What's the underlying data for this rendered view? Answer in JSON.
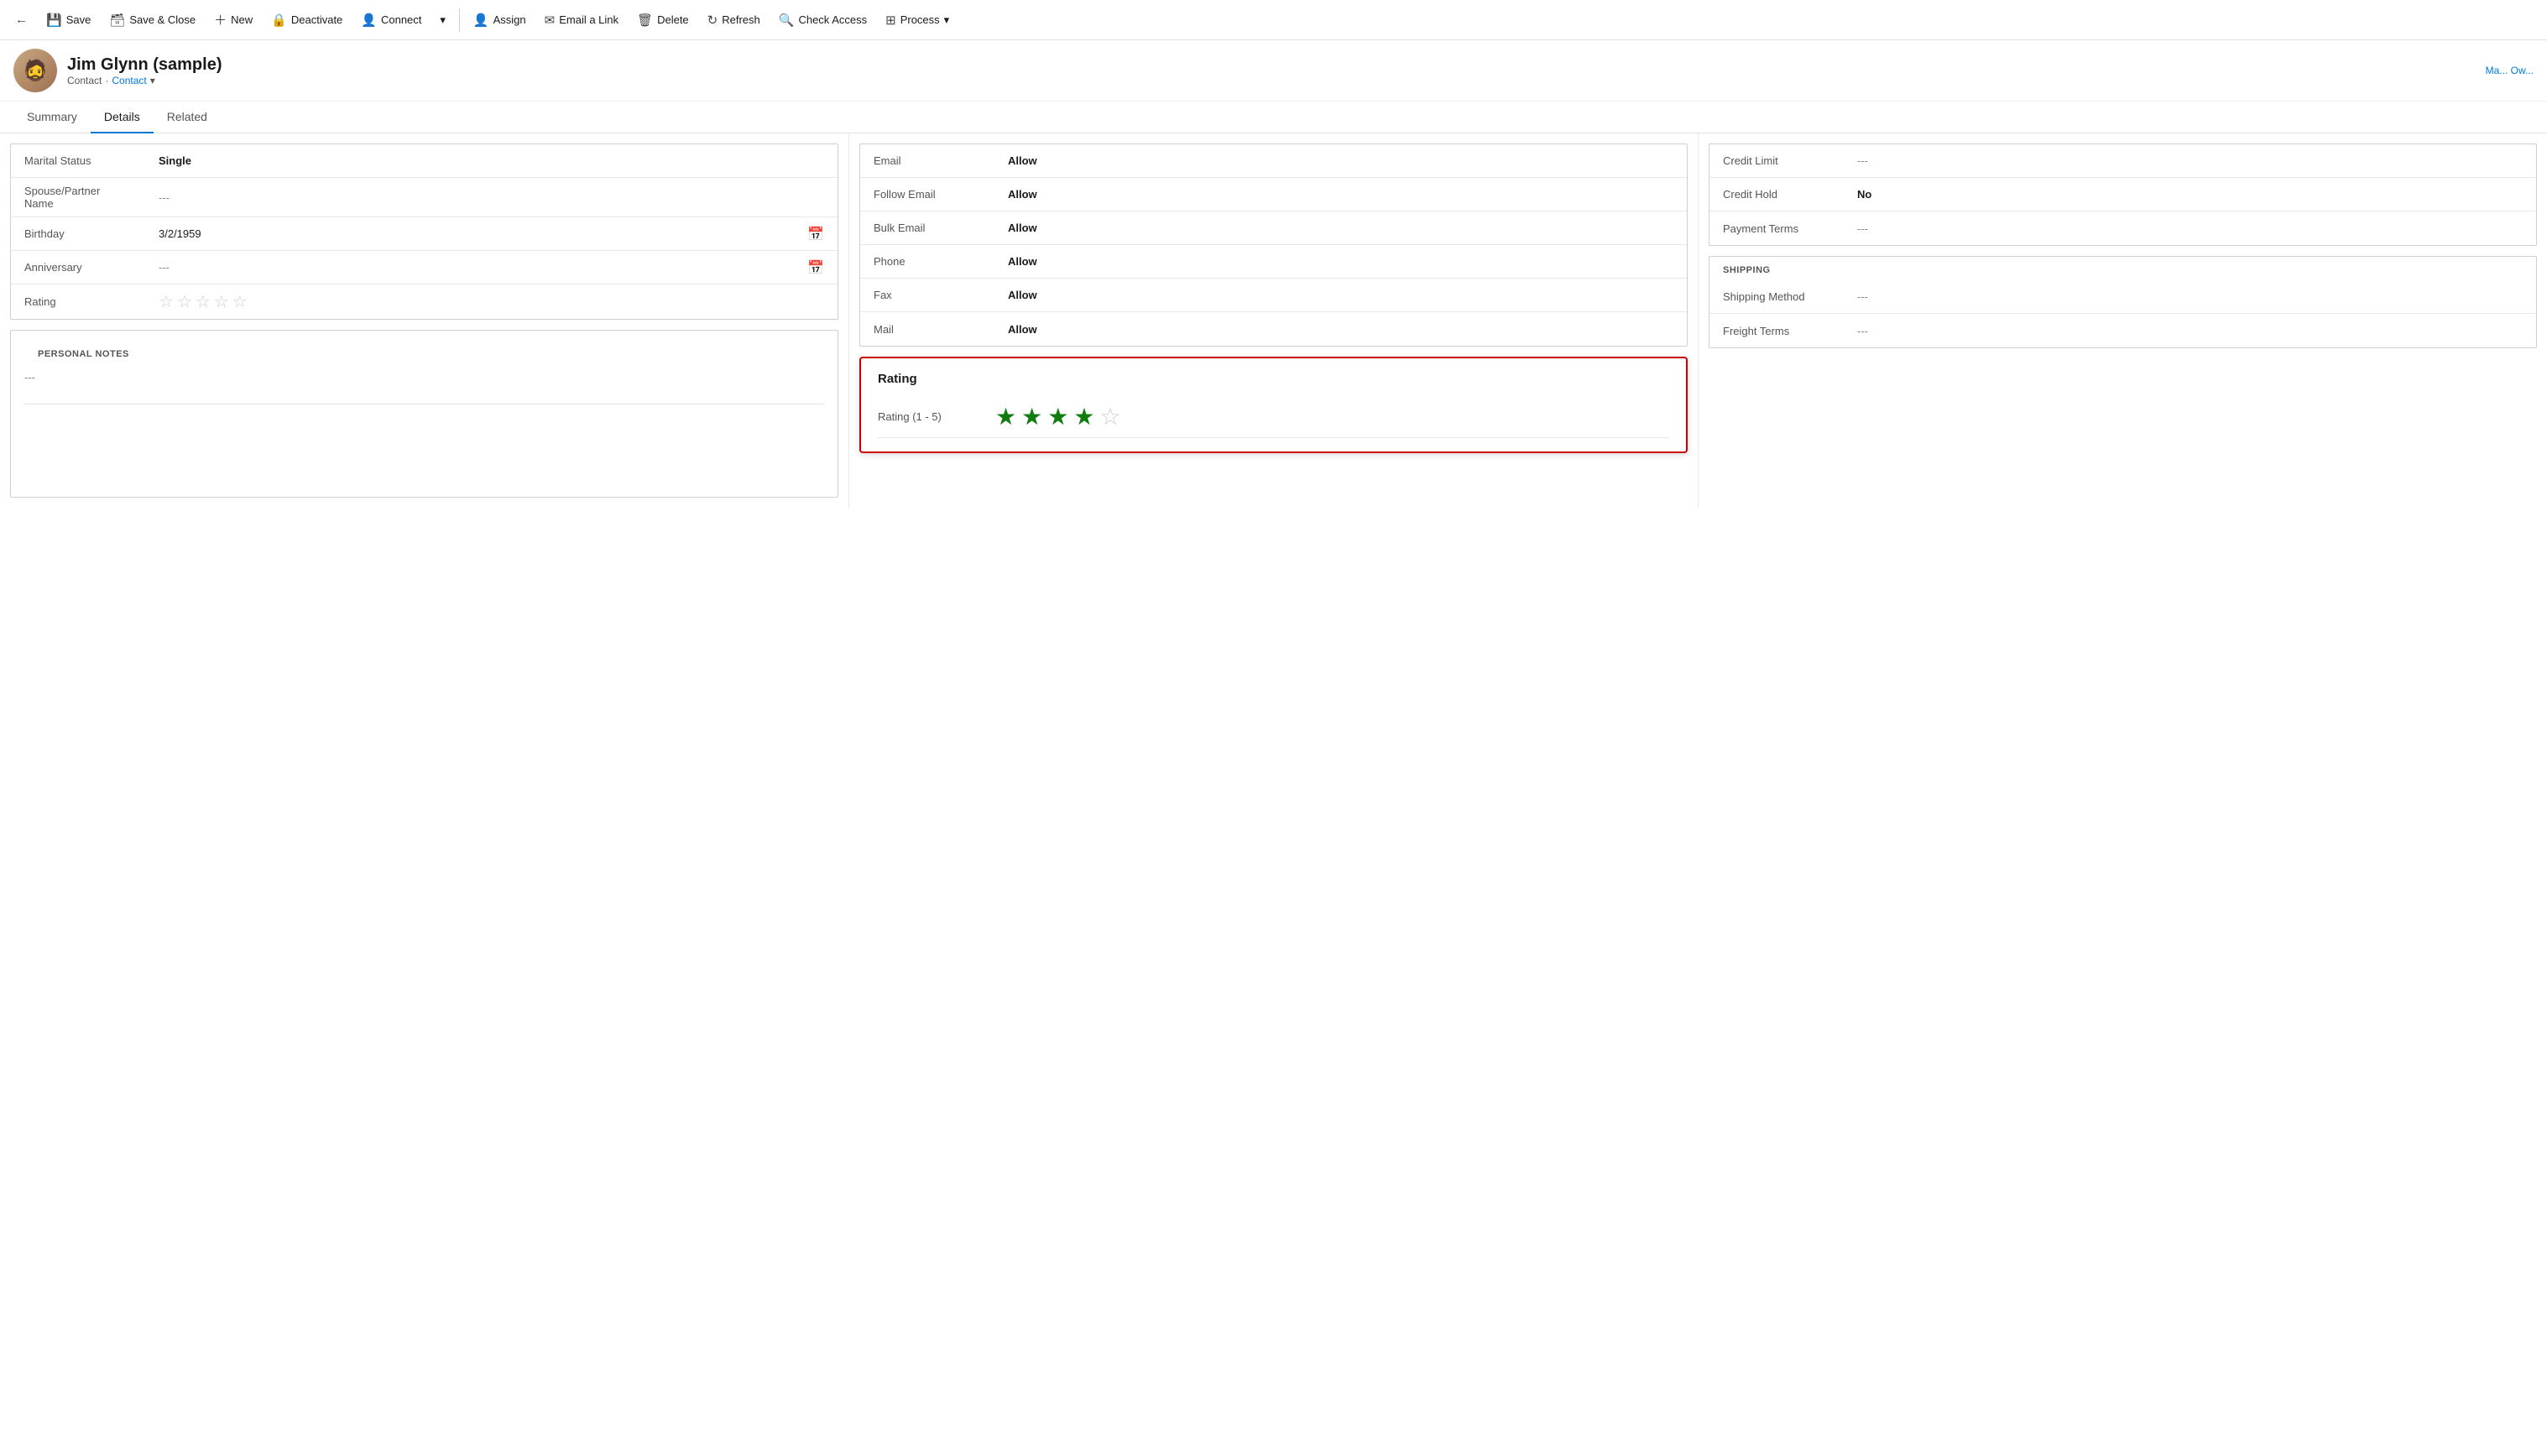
{
  "toolbar": {
    "back_icon": "←",
    "save_label": "Save",
    "save_close_label": "Save & Close",
    "new_label": "New",
    "deactivate_label": "Deactivate",
    "connect_label": "Connect",
    "dropdown_icon": "▾",
    "assign_label": "Assign",
    "email_link_label": "Email a Link",
    "delete_label": "Delete",
    "refresh_label": "Refresh",
    "check_access_label": "Check Access",
    "process_label": "Process",
    "process_more_icon": "▾"
  },
  "header": {
    "name": "Jim Glynn (sample)",
    "type_label": "Contact",
    "type_link": "Contact",
    "dropdown_icon": "▾",
    "right_user": "Ma...\nOw..."
  },
  "tabs": [
    {
      "label": "Summary",
      "active": false
    },
    {
      "label": "Details",
      "active": true
    },
    {
      "label": "Related",
      "active": false
    }
  ],
  "personal_info": {
    "section": "",
    "fields": [
      {
        "label": "Marital Status",
        "value": "Single",
        "bold": true
      },
      {
        "label": "Spouse/Partner Name",
        "value": "---",
        "bold": false
      },
      {
        "label": "Birthday",
        "value": "3/2/1959",
        "has_calendar": true
      },
      {
        "label": "Anniversary",
        "value": "---",
        "has_calendar": true
      },
      {
        "label": "Rating",
        "value": "stars_empty",
        "stars": 5,
        "filled": 0
      }
    ]
  },
  "personal_notes": {
    "title": "PERSONAL NOTES",
    "value": "---"
  },
  "contact_preferences": {
    "fields": [
      {
        "label": "Email",
        "value": "Allow"
      },
      {
        "label": "Follow Email",
        "value": "Allow"
      },
      {
        "label": "Bulk Email",
        "value": "Allow"
      },
      {
        "label": "Phone",
        "value": "Allow"
      },
      {
        "label": "Fax",
        "value": "Allow"
      },
      {
        "label": "Mail",
        "value": "Allow"
      }
    ]
  },
  "rating_popup": {
    "title": "Rating",
    "label": "Rating (1 - 5)",
    "total_stars": 5,
    "filled_stars": 4
  },
  "billing": {
    "fields": [
      {
        "label": "Credit Limit",
        "value": "---"
      },
      {
        "label": "Credit Hold",
        "value": "No",
        "bold": true
      },
      {
        "label": "Payment Terms",
        "value": "---"
      }
    ]
  },
  "shipping": {
    "title": "SHIPPING",
    "fields": [
      {
        "label": "Shipping Method",
        "value": "---"
      },
      {
        "label": "Freight Terms",
        "value": "---"
      }
    ]
  },
  "icons": {
    "save": "💾",
    "save_close": "🗃",
    "new": "＋",
    "deactivate": "🔒",
    "connect": "👤",
    "assign": "👤",
    "email_link": "✉",
    "delete": "🗑",
    "refresh": "↻",
    "check_access": "🔍",
    "process": "⊞",
    "calendar": "📅",
    "back": "←"
  }
}
